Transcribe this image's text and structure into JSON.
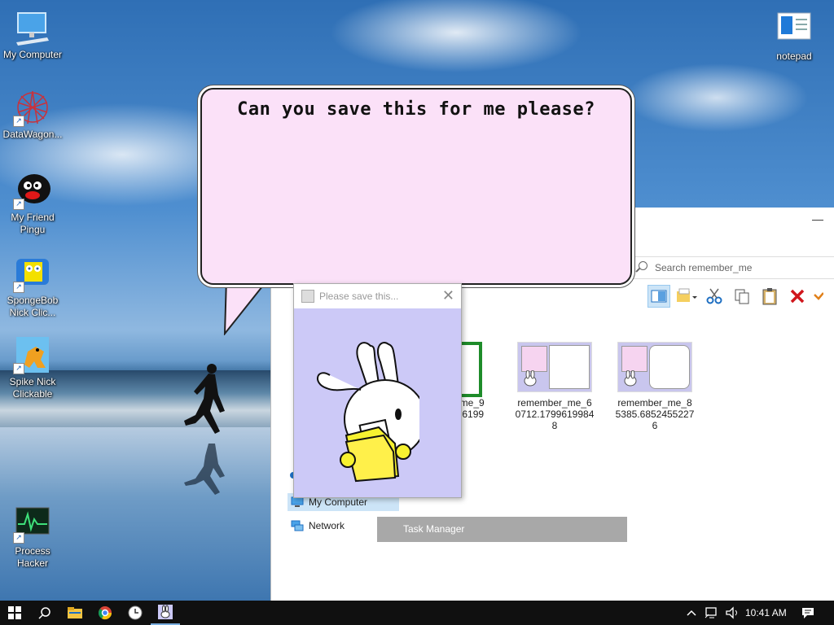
{
  "desktop_icons": [
    {
      "label": "My Computer"
    },
    {
      "label": "DataWagon..."
    },
    {
      "label": "My Friend Pingu"
    },
    {
      "label": "SpongeBob Nick Clic..."
    },
    {
      "label": "Spike Nick Clickable"
    },
    {
      "label": "Process Hacker"
    },
    {
      "label": "notepad"
    }
  ],
  "bubble": {
    "text": "Can you save this for me please?"
  },
  "popup": {
    "title": "Please save this..."
  },
  "explorer": {
    "search_placeholder": "Search remember_me",
    "files": [
      {
        "name": "r_me_9\n406199"
      },
      {
        "name": "remember_me_6\n0712.1799619984\n8"
      },
      {
        "name": "remember_me_8\n5385.6852455227\n6"
      }
    ],
    "nav": [
      {
        "label": "My Computer"
      },
      {
        "label": "Network"
      }
    ],
    "task_manager_label": "Task Manager"
  },
  "taskbar": {
    "time": "10:41 AM"
  },
  "colors": {
    "bubble": "#fbe1f8",
    "popup_bg": "#ccc9f7",
    "taskbar": "#101010",
    "close_red": "#d0161c"
  }
}
